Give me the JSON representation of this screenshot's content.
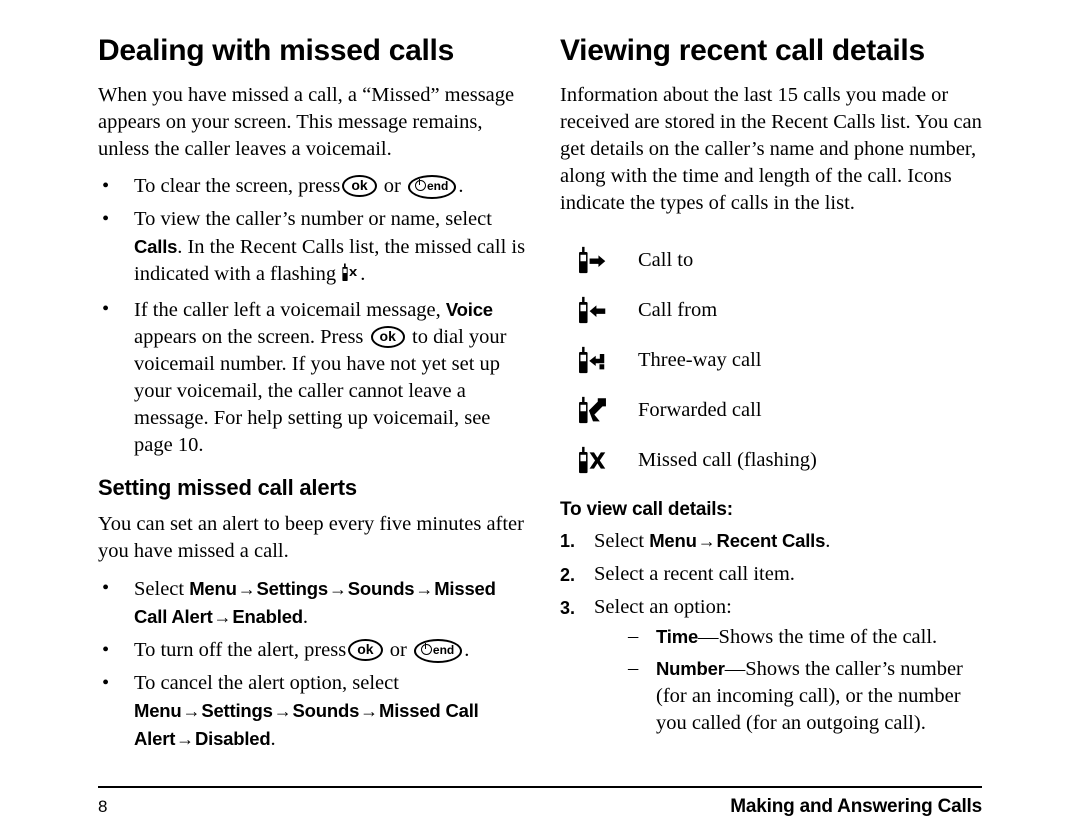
{
  "page": {
    "number": "8",
    "footer_title": "Making and Answering Calls"
  },
  "left_column": {
    "heading": "Dealing with missed calls",
    "intro": "When you have missed a call, a “Missed” message appears on your screen. This message remains, unless the caller leaves a voicemail.",
    "bullets": [
      {
        "id": "clear-screen",
        "before": "To clear the screen, press",
        "keys": [
          "ok",
          "end"
        ],
        "conjunction": "or",
        "after": "."
      },
      {
        "id": "view-caller",
        "part1": "To view the caller’s number or name, select ",
        "bold1": "Calls",
        "part2": ". In the Recent Calls list, the missed call is indicated with a flashing ",
        "icon": "phone-missed-icon",
        "part3": "."
      },
      {
        "id": "voicemail",
        "part1": "If the caller left a voicemail message, ",
        "bold1": "Voice",
        "part2": " appears on the screen. Press ",
        "key": "ok",
        "part3": " to dial your voicemail number. If you have not yet set up your voicemail, the caller cannot leave a message. For help setting up voicemail, see page 10."
      }
    ],
    "subheading": "Setting missed call alerts",
    "sub_intro": "You can set an alert to beep every five minutes after you have missed a call.",
    "sub_bullets": [
      {
        "id": "enable-alert",
        "lead": "Select ",
        "path": [
          "Menu",
          "Settings",
          "Sounds",
          "Missed Call Alert",
          "Enabled"
        ],
        "trailing": "."
      },
      {
        "id": "turn-off-alert",
        "before": "To turn off the alert, press",
        "keys": [
          "ok",
          "end"
        ],
        "conjunction": "or",
        "after": "."
      },
      {
        "id": "cancel-alert",
        "lead": "To cancel the alert option, select ",
        "path": [
          "Menu",
          "Settings",
          "Sounds",
          "Missed Call Alert",
          "Disabled"
        ],
        "trailing": "."
      }
    ]
  },
  "right_column": {
    "heading": "Viewing recent call details",
    "intro": "Information about the last 15 calls you made or received are stored in the Recent Calls list. You can get details on the caller’s name and phone number, along with the time and length of the call. Icons indicate the types of calls in the list.",
    "icon_legend": [
      {
        "icon": "phone-call-to-icon",
        "label": "Call to"
      },
      {
        "icon": "phone-call-from-icon",
        "label": "Call from"
      },
      {
        "icon": "phone-three-way-icon",
        "label": "Three-way call"
      },
      {
        "icon": "phone-forwarded-icon",
        "label": "Forwarded call"
      },
      {
        "icon": "phone-missed-icon",
        "label": "Missed call (flashing)"
      }
    ],
    "procedure_title": "To view call details:",
    "steps": [
      {
        "num": "1.",
        "lead": "Select ",
        "path": [
          "Menu",
          "Recent Calls"
        ],
        "trailing": "."
      },
      {
        "num": "2.",
        "text": "Select a recent call item."
      },
      {
        "num": "3.",
        "text": "Select an option:",
        "subitems": [
          {
            "bold": "Time",
            "text": "—Shows the time of the call."
          },
          {
            "bold": "Number",
            "text": "—Shows the caller’s number (for an incoming call), or the number you called (for an outgoing call)."
          }
        ]
      }
    ]
  },
  "symbols": {
    "arrow": "→",
    "bullet": "•",
    "dash": "–",
    "key_ok": "ok",
    "key_end": "end"
  },
  "colors": {
    "text": "#000000",
    "background": "#ffffff"
  }
}
